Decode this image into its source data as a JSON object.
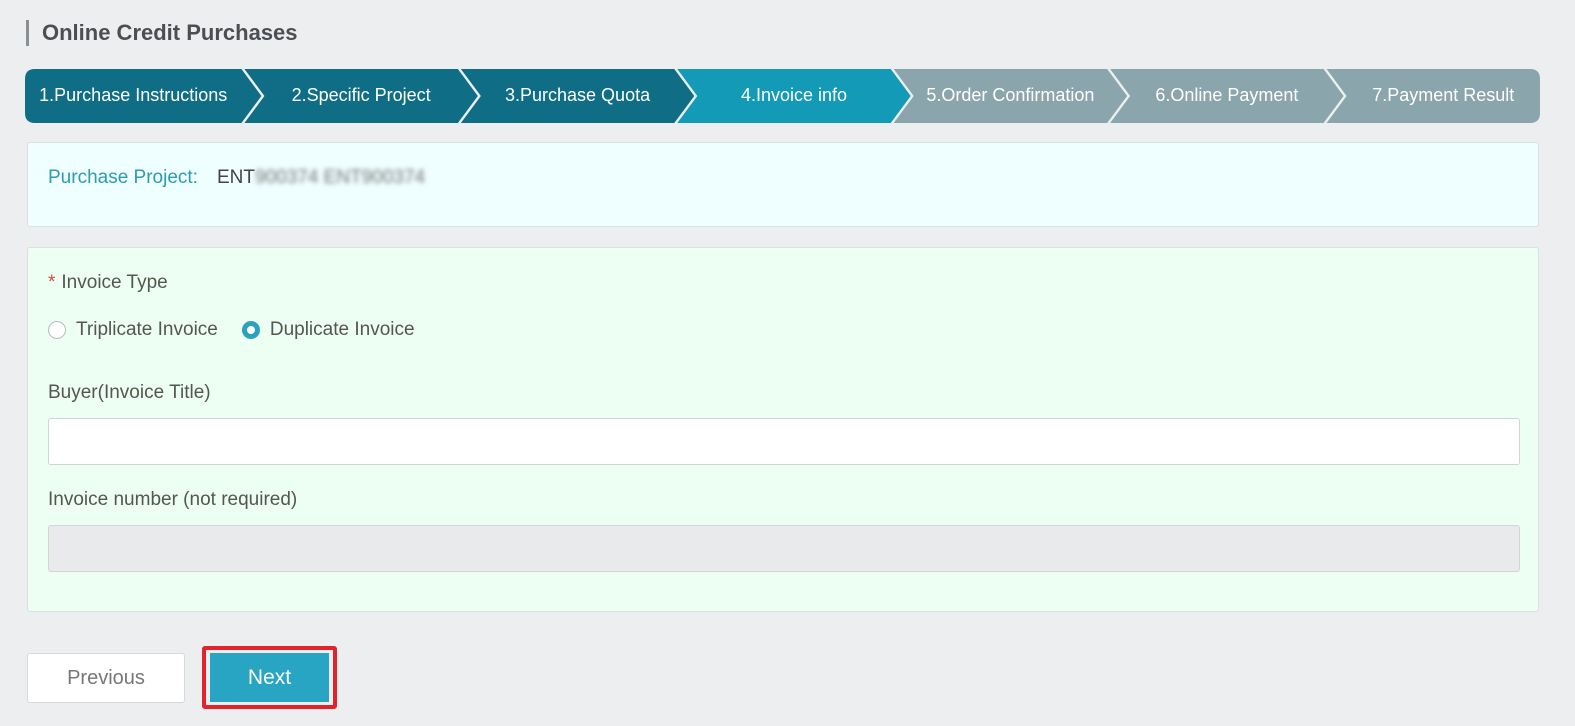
{
  "page": {
    "title": "Online Credit Purchases"
  },
  "steps": [
    {
      "label": "1.Purchase Instructions",
      "state": "done"
    },
    {
      "label": "2.Specific Project",
      "state": "done"
    },
    {
      "label": "3.Purchase Quota",
      "state": "done"
    },
    {
      "label": "4.Invoice info",
      "state": "active"
    },
    {
      "label": "5.Order Confirmation",
      "state": "pending"
    },
    {
      "label": "6.Online Payment",
      "state": "pending"
    },
    {
      "label": "7.Payment Result",
      "state": "pending"
    }
  ],
  "colors": {
    "done": "#0f6e86",
    "active": "#139ab6",
    "pending": "#8aa5ab",
    "highlight": "#e3222c"
  },
  "project": {
    "label": "Purchase Project:",
    "value_visible": "ENT",
    "value_blurred": "900374 ENT900374"
  },
  "form": {
    "invoice_type": {
      "required_mark": "*",
      "label": "Invoice Type",
      "options": [
        {
          "label": "Triplicate Invoice",
          "selected": false
        },
        {
          "label": "Duplicate Invoice",
          "selected": true
        }
      ]
    },
    "buyer": {
      "label": "Buyer(Invoice Title)",
      "value": "",
      "placeholder": ""
    },
    "invoice_number": {
      "label": "Invoice number (not required)",
      "value": "",
      "disabled": true
    }
  },
  "actions": {
    "previous_label": "Previous",
    "next_label": "Next"
  }
}
